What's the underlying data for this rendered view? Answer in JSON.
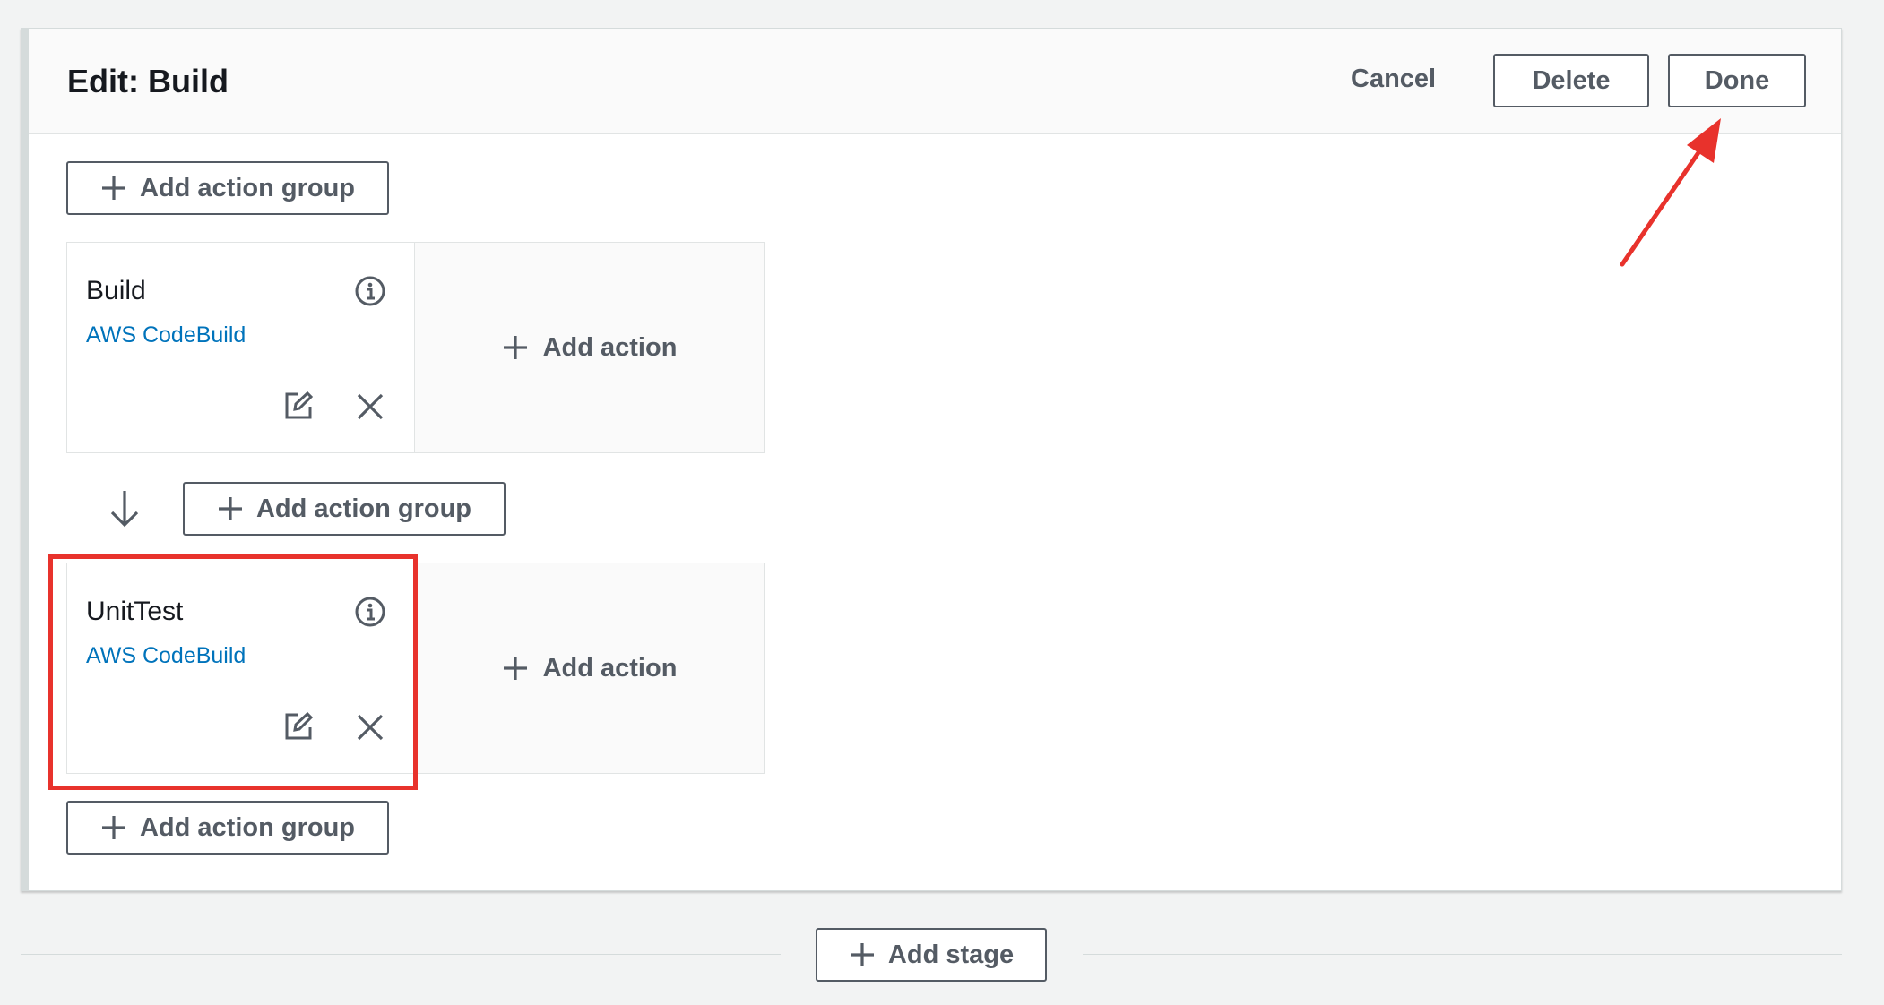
{
  "panel": {
    "title": "Edit: Build",
    "cancel_label": "Cancel",
    "delete_label": "Delete",
    "done_label": "Done"
  },
  "add_action_group_label": "Add action group",
  "add_action_label": "Add action",
  "add_stage_label": "Add stage",
  "action_groups": [
    {
      "name": "Build",
      "provider": "AWS CodeBuild"
    },
    {
      "name": "UnitTest",
      "provider": "AWS CodeBuild"
    }
  ],
  "icons": [
    "plus-icon",
    "info-icon",
    "edit-icon",
    "close-icon",
    "arrow-down-icon"
  ],
  "colors": {
    "link": "#0073bb",
    "button_text": "#545b64",
    "highlight": "#e8322c",
    "background": "#f2f3f3"
  }
}
